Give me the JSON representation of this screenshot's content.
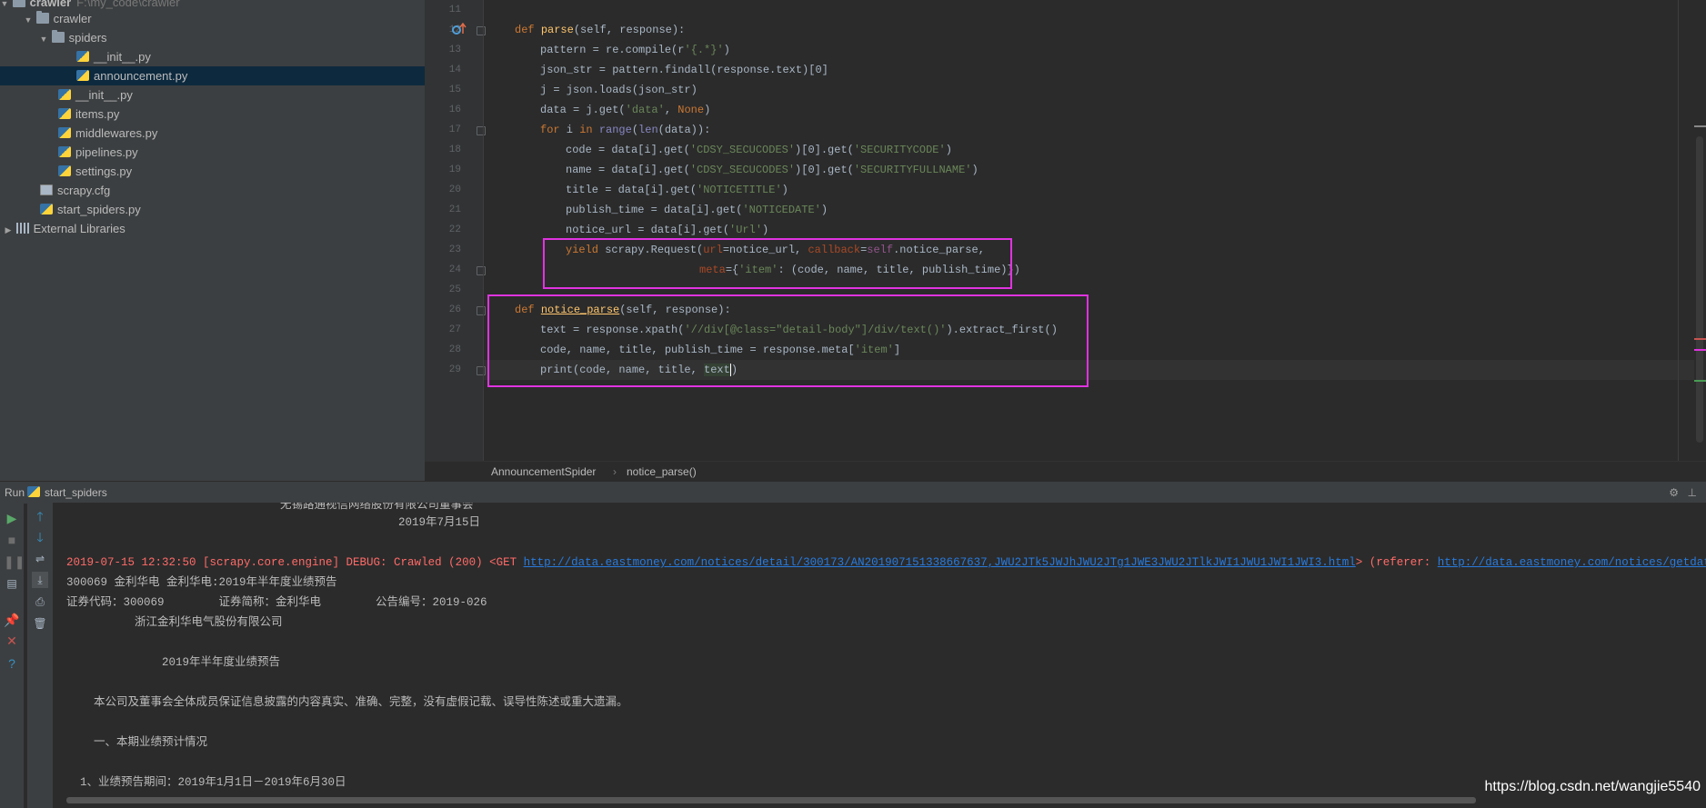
{
  "project_tree": {
    "root": {
      "label": "crawler",
      "path": "F:\\my_code\\crawler"
    },
    "items": [
      {
        "label": "crawler",
        "type": "folder"
      },
      {
        "label": "spiders",
        "type": "folder"
      },
      {
        "label": "__init__.py",
        "type": "py"
      },
      {
        "label": "announcement.py",
        "type": "py",
        "selected": true
      },
      {
        "label": "__init__.py",
        "type": "py"
      },
      {
        "label": "items.py",
        "type": "py"
      },
      {
        "label": "middlewares.py",
        "type": "py"
      },
      {
        "label": "pipelines.py",
        "type": "py"
      },
      {
        "label": "settings.py",
        "type": "py"
      },
      {
        "label": "scrapy.cfg",
        "type": "cfg"
      },
      {
        "label": "start_spiders.py",
        "type": "py"
      },
      {
        "label": "External Libraries",
        "type": "libs"
      }
    ]
  },
  "editor": {
    "line_numbers": [
      "11",
      "12",
      "13",
      "14",
      "15",
      "16",
      "17",
      "18",
      "19",
      "20",
      "21",
      "22",
      "23",
      "24",
      "25",
      "26",
      "27",
      "28",
      "29"
    ],
    "code": {
      "l12_def": "def",
      "l12_name": "parse",
      "l12_rest": "(self, response):",
      "l13_a": "pattern = re.compile(r",
      "l13_str": "'{.*}'",
      "l13_b": ")",
      "l14": "json_str = pattern.findall(response.text)[0]",
      "l15": "j = json.loads(json_str)",
      "l16_a": "data = j.get(",
      "l16_str": "'data'",
      "l16_b": ", ",
      "l16_none": "None",
      "l16_c": ")",
      "l17_for": "for",
      "l17_a": " i ",
      "l17_in": "in",
      "l17_b": " ",
      "l17_range": "range",
      "l17_c": "(",
      "l17_len": "len",
      "l17_d": "(data)):",
      "l18_a": "code = data[i].get(",
      "l18_s1": "'CDSY_SECUCODES'",
      "l18_b": ")[0].get(",
      "l18_s2": "'SECURITYCODE'",
      "l18_c": ")",
      "l19_a": "name = data[i].get(",
      "l19_s1": "'CDSY_SECUCODES'",
      "l19_b": ")[0].get(",
      "l19_s2": "'SECURITYFULLNAME'",
      "l19_c": ")",
      "l20_a": "title = data[i].get(",
      "l20_s": "'NOTICETITLE'",
      "l20_b": ")",
      "l21_a": "publish_time = data[i].get(",
      "l21_s": "'NOTICEDATE'",
      "l21_b": ")",
      "l22_a": "notice_url = data[i].get(",
      "l22_s": "'Url'",
      "l22_b": ")",
      "l23_yield": "yield",
      "l23_a": " scrapy.Request(",
      "l23_url": "url",
      "l23_b": "=notice_url, ",
      "l23_cb": "callback",
      "l23_c": "=",
      "l23_self": "self",
      "l23_d": ".notice_parse,",
      "l24_meta": "meta",
      "l24_a": "={",
      "l24_s": "'item'",
      "l24_b": ": (code, name, title, publish_time)})",
      "l26_def": "def",
      "l26_name": "notice_parse",
      "l26_rest": "(self, response):",
      "l27_a": "text = response.xpath(",
      "l27_s": "'//div[@class=\"detail-body\"]/div/text()'",
      "l27_b": ").extract_first()",
      "l28_a": "code, name, title, publish_time = response.meta[",
      "l28_s": "'item'",
      "l28_b": "]",
      "l29_a": "print(code, name, title, ",
      "l29_b": "text",
      "l29_c": ")"
    }
  },
  "breadcrumb": {
    "class_name": "AnnouncementSpider",
    "separator": "›",
    "method": "notice_parse()"
  },
  "run_panel": {
    "label": "Run",
    "tab": "start_spiders",
    "console": {
      "partial_top": "无锡路通视信网络股份有限公司董事会",
      "date_line": "2019年7月15日",
      "debug_prefix": "2019-07-15 12:32:50 [scrapy.core.engine] DEBUG: Crawled (200) <GET ",
      "debug_url": "http://data.eastmoney.com/notices/detail/300173/AN201907151338667637,JWU2JTk5JWJhJWU2JTg1JWE3JWU2JTlkJWI1JWU1JWI1JWI3.html",
      "debug_mid": "> (referer: ",
      "debug_ref": "http://data.eastmoney.com/notices/getdata.ashx?StockCode=",
      "line1": "300069 金利华电 金利华电:2019年半年度业绩预告",
      "line2": "证券代码：300069        证券简称：金利华电        公告编号：2019-026",
      "line3": "          浙江金利华电气股份有限公司",
      "line4": "              2019年半年度业绩预告",
      "line5": "    本公司及董事会全体成员保证信息披露的内容真实、准确、完整，没有虚假记载、误导性陈述或重大遗漏。",
      "line6": "    一、本期业绩预计情况",
      "line7": "  1、业绩预告期间：2019年1月1日－2019年6月30日"
    }
  },
  "watermark": "https://blog.csdn.net/wangjie5540",
  "colors": {
    "highlight_box": "#e033e0",
    "selection": "#0d293e",
    "debug_red": "#ff6b68",
    "link": "#287bde"
  }
}
